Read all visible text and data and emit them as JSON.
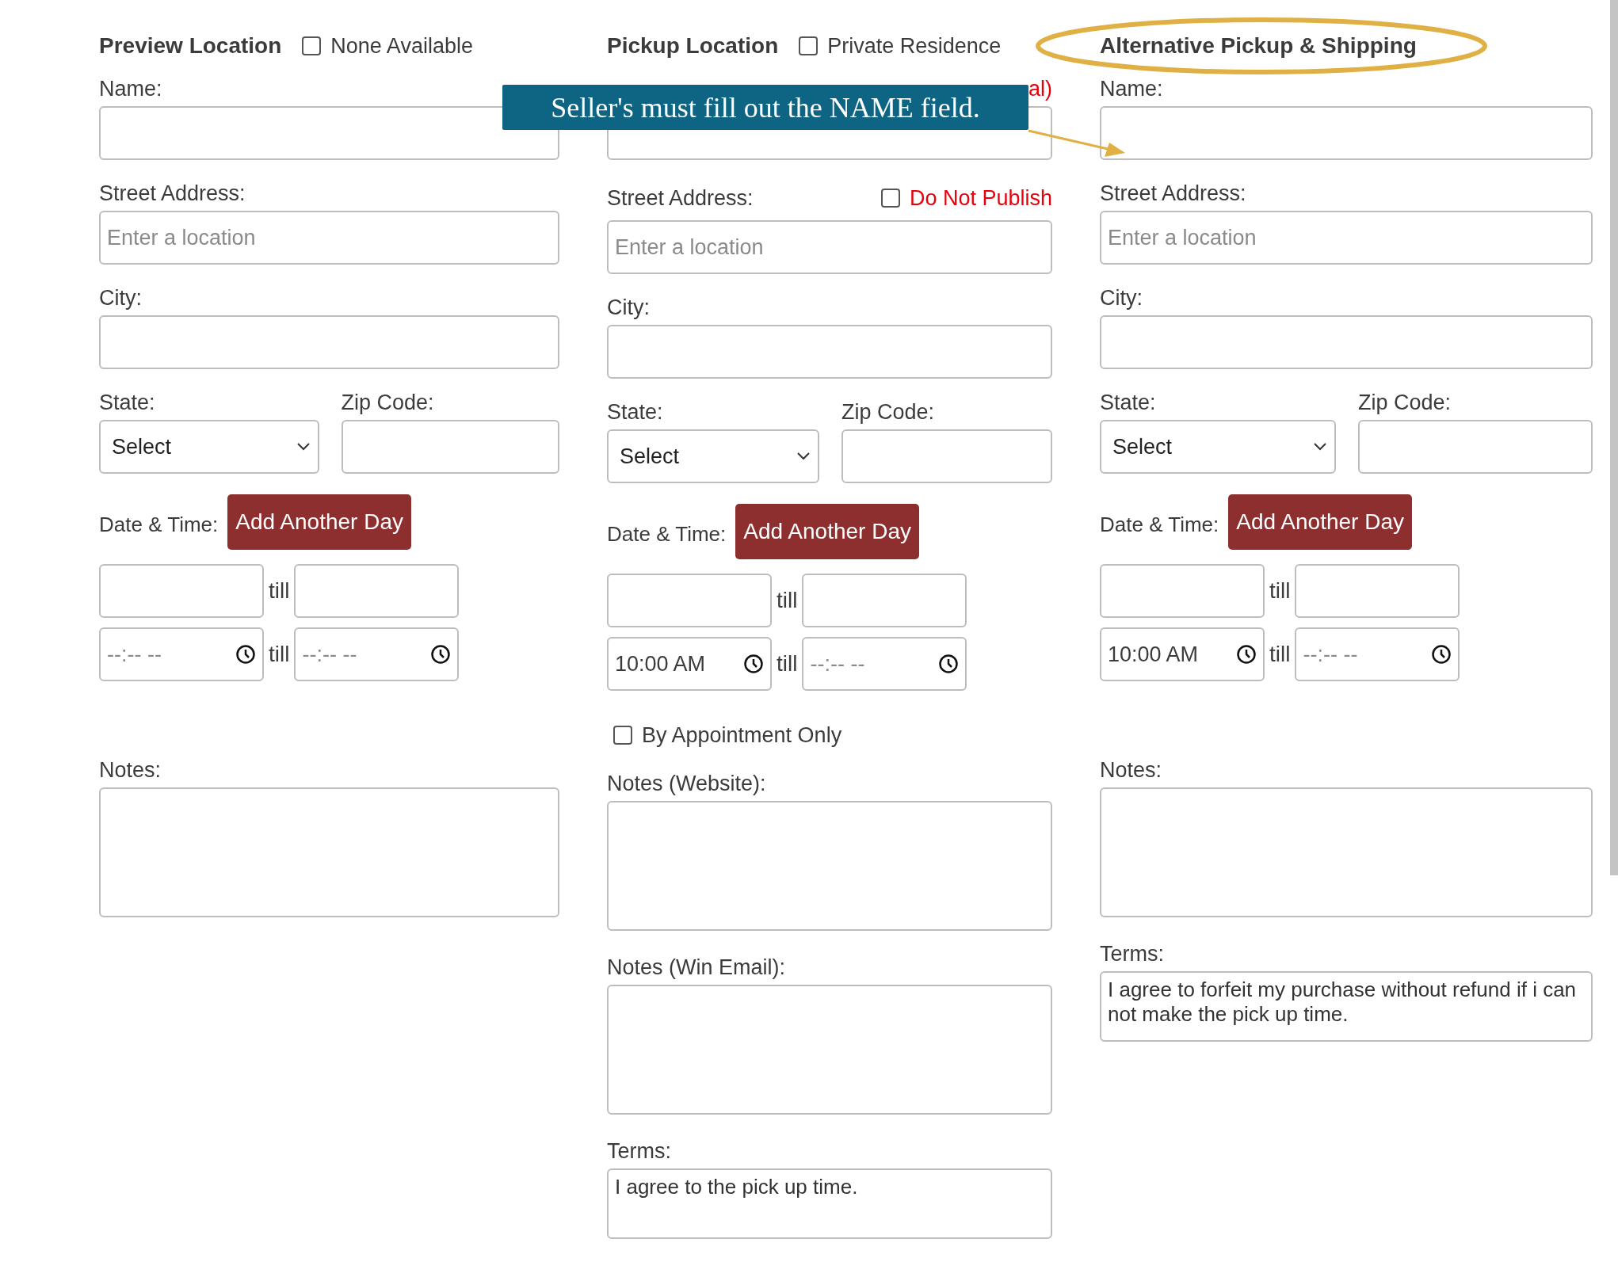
{
  "columns": [
    {
      "title": "Preview Location",
      "option": {
        "label": "None Available",
        "checked": false
      },
      "fields": [
        {
          "kind": "text",
          "label": "Name:"
        },
        {
          "kind": "text",
          "label": "Street Address:",
          "placeholder": "Enter a location"
        },
        {
          "kind": "text",
          "label": "City:"
        },
        {
          "kind": "state_zip",
          "state_label": "State:",
          "state_value": "Select",
          "zip_label": "Zip Code:"
        },
        {
          "kind": "datetime",
          "label": "Date & Time:",
          "button": "Add Another Day",
          "till_date": "till",
          "till_time": "till",
          "start_time": {
            "placeholder": "--:-- --"
          },
          "end_time": {
            "placeholder": "--:-- --"
          }
        },
        {
          "kind": "notes",
          "label": "Notes:"
        }
      ]
    },
    {
      "title": "Pickup Location",
      "option": {
        "label": "Private Residence",
        "checked": false
      },
      "fields": [
        {
          "kind": "text",
          "note": "al)"
        },
        {
          "kind": "text",
          "label": "Street Address:",
          "placeholder": "Enter a location",
          "publish_option": {
            "label": "Do Not Publish",
            "checked": false
          }
        },
        {
          "kind": "text",
          "label": "City:"
        },
        {
          "kind": "state_zip",
          "state_label": "State:",
          "state_value": "Select",
          "zip_label": "Zip Code:"
        },
        {
          "kind": "datetime",
          "label": "Date & Time:",
          "button": "Add Another Day",
          "till_date": "till",
          "till_time": "till",
          "start_time": {
            "value": "10:00 AM"
          },
          "end_time": {
            "placeholder": "--:-- --"
          }
        },
        {
          "kind": "checkbox",
          "label": "By Appointment Only",
          "checked": false
        },
        {
          "kind": "notes",
          "label": "Notes (Website):"
        },
        {
          "kind": "notes",
          "label": "Notes (Win Email):"
        },
        {
          "kind": "terms",
          "label": "Terms:",
          "value": "I agree to the pick up time."
        }
      ]
    },
    {
      "title": "Alternative Pickup & Shipping",
      "highlighted": true,
      "fields": [
        {
          "kind": "text",
          "label": "Name:"
        },
        {
          "kind": "text",
          "label": "Street Address:",
          "placeholder": "Enter a location"
        },
        {
          "kind": "text",
          "label": "City:"
        },
        {
          "kind": "state_zip",
          "state_label": "State:",
          "state_value": "Select",
          "zip_label": "Zip Code:"
        },
        {
          "kind": "datetime",
          "label": "Date & Time:",
          "button": "Add Another Day",
          "till_date": "till",
          "till_time": "till",
          "start_time": {
            "value": "10:00 AM"
          },
          "end_time": {
            "placeholder": "--:-- --"
          }
        },
        {
          "kind": "notes",
          "label": "Notes:"
        },
        {
          "kind": "terms",
          "label": "Terms:",
          "value": "I agree to forfeit my purchase without refund if i can not make the pick up time."
        }
      ]
    }
  ],
  "callout": {
    "text": "Seller's must fill out the NAME field."
  }
}
